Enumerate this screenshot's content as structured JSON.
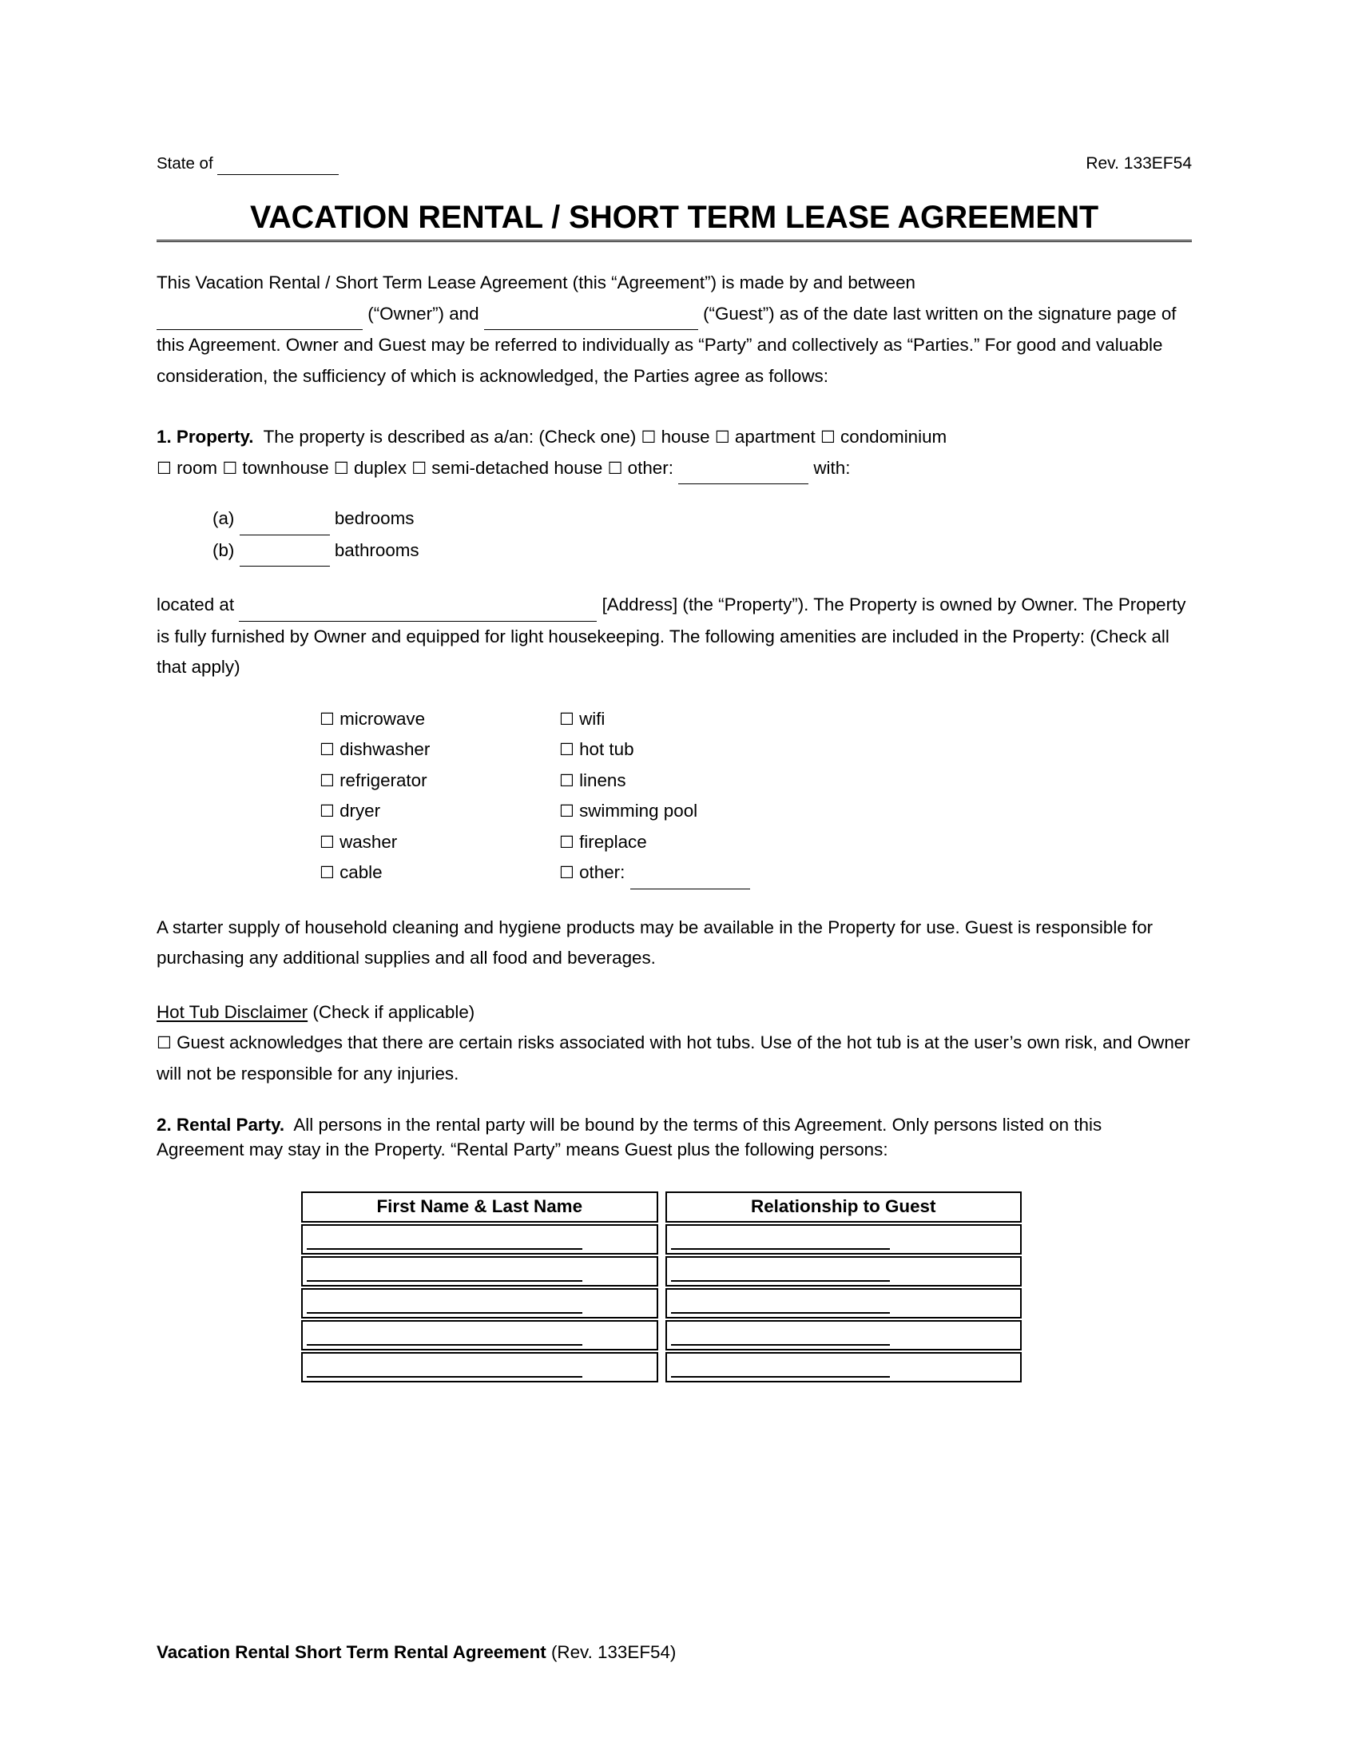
{
  "header": {
    "state_label": "State of",
    "state_blank": "______________",
    "revision": "Rev. 133EF54"
  },
  "title": "VACATION RENTAL / SHORT TERM LEASE AGREEMENT",
  "intro": {
    "line1": "This Vacation Rental / Short Term Lease Agreement (this “Agreement”) is made by and between",
    "blank_owner": "________________________",
    "owner_label": "(“Owner”) and",
    "blank_guest": "________________________",
    "guest_label": "(“Guest”) as of the date last",
    "rest": "written on the signature page of this Agreement. Owner and Guest may be referred to individually as “Party” and collectively as “Parties.” For good and valuable consideration, the sufficiency of which is acknowledged, the Parties agree as follows:"
  },
  "section1": {
    "number_title": "1. Property.",
    "lead": "The property is described as a/an: (Check one)",
    "checkbox_glyph": "☐",
    "types_line1": [
      "house",
      "apartment",
      "condominium"
    ],
    "types_line2": [
      "room",
      "townhouse",
      "duplex",
      "semi-detached house"
    ],
    "other_label": "other:",
    "other_blank": "_______________",
    "with_label": "with:",
    "counts": [
      {
        "marker": "(a)",
        "blank": "__________",
        "label": "bedrooms"
      },
      {
        "marker": "(b)",
        "blank": "__________",
        "label": "bathrooms"
      }
    ],
    "located_prefix": "located at",
    "located_blank": "_______________________________________________",
    "located_suffix": "[Address] (the “Property”). The Property is owned by Owner. The Property is fully furnished by Owner and equipped for light housekeeping. The following amenities are included in the Property: (Check all that apply)",
    "amenities_col1": [
      "microwave",
      "dishwasher",
      "refrigerator",
      "dryer",
      "washer",
      "cable"
    ],
    "amenities_col2": [
      "wifi",
      "hot tub",
      "linens",
      "swimming pool",
      "fireplace",
      "other:"
    ],
    "amenities_other_blank": "_______________",
    "starter_supply": "A starter supply of household cleaning and hygiene products may be available in the Property for use. Guest is responsible for purchasing any additional supplies and all food and beverages.",
    "hot_tub_heading": "Hot Tub Disclaimer",
    "hot_tub_check_note": "(Check if applicable)",
    "hot_tub_text": "Guest acknowledges that there are certain risks associated with hot tubs. Use of the hot tub is at the user’s own risk, and Owner will not be responsible for any injuries."
  },
  "section2": {
    "number_title": "2. Rental Party.",
    "text": "All persons in the rental party will be bound by the terms of this Agreement. Only persons listed on this Agreement may stay in the Property. “Rental Party” means Guest plus the following persons:",
    "table": {
      "columns": [
        "First Name & Last Name",
        "Relationship to Guest"
      ],
      "rows": [
        [
          "",
          ""
        ],
        [
          "",
          ""
        ],
        [
          "",
          ""
        ],
        [
          "",
          ""
        ],
        [
          "",
          ""
        ]
      ]
    }
  },
  "footer": {
    "title": "Vacation Rental Short Term Rental Agreement",
    "revision": "(Rev. 133EF54)"
  }
}
